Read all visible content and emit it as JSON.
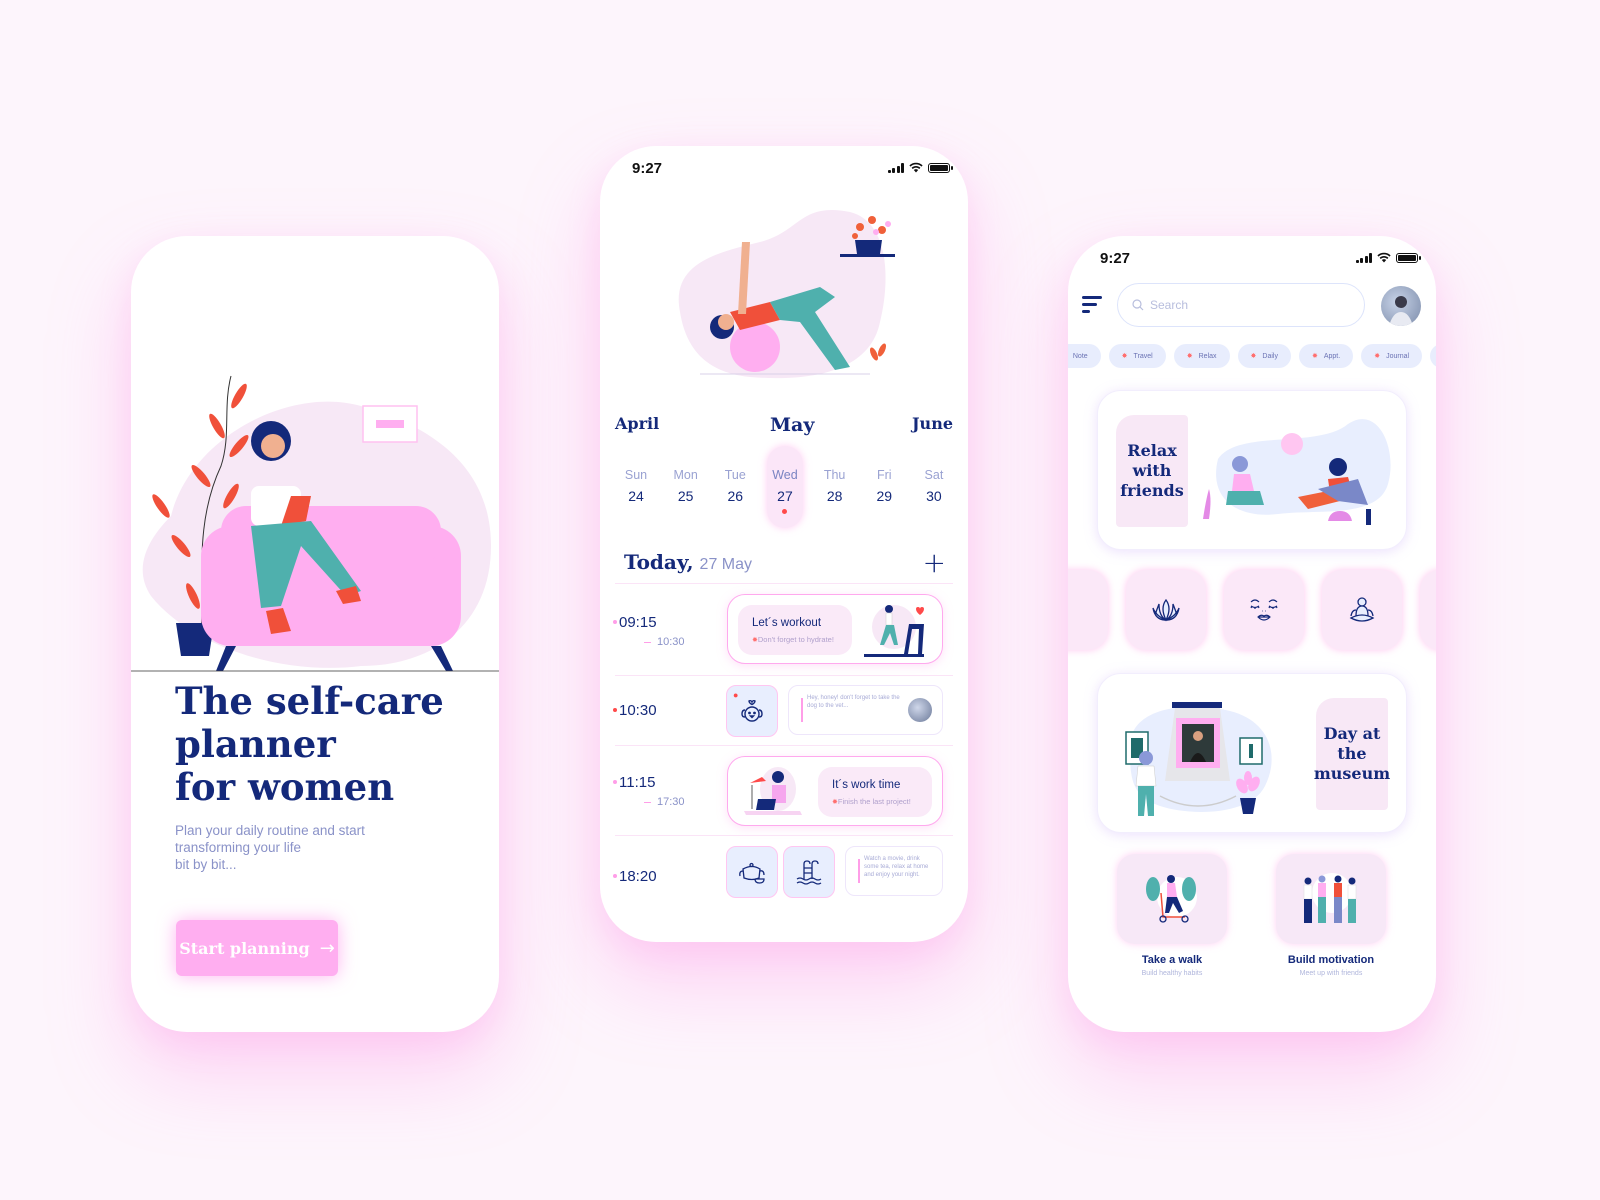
{
  "colors": {
    "navy": "#14297a",
    "pink": "#ffaef0",
    "soft_pink": "#faeaf8",
    "lavender": "#e8eefe",
    "red_dot": "#ff4a4a",
    "background": "#fdf5fc"
  },
  "onboarding": {
    "title_line1": "The self-care",
    "title_line2": "planner",
    "title_line3": "for women",
    "subtitle_line1": "Plan your daily routine and start",
    "subtitle_line2": "transforming your life",
    "subtitle_line3": "bit by bit...",
    "cta_label": "Start planning",
    "cta_icon": "arrow-right-icon"
  },
  "planner": {
    "status_time": "9:27",
    "months": {
      "prev": "April",
      "current": "May",
      "next": "June"
    },
    "days": [
      {
        "name": "Sun",
        "date": "24",
        "selected": false
      },
      {
        "name": "Mon",
        "date": "25",
        "selected": false
      },
      {
        "name": "Tue",
        "date": "26",
        "selected": false
      },
      {
        "name": "Wed",
        "date": "27",
        "selected": true
      },
      {
        "name": "Thu",
        "date": "28",
        "selected": false
      },
      {
        "name": "Fri",
        "date": "29",
        "selected": false
      },
      {
        "name": "Sat",
        "date": "30",
        "selected": false
      }
    ],
    "today_label": "Today,",
    "today_date": "27 May",
    "add_icon": "plus-icon",
    "schedule": [
      {
        "start": "09:15",
        "end": "10:30",
        "title": "Let´s workout",
        "note": "Don't forget to hydrate!"
      },
      {
        "start": "10:30",
        "icon": "dog-icon",
        "message": "Hey, honey! don't forget to take the dog to the vet..."
      },
      {
        "start": "11:15",
        "end": "17:30",
        "title": "It´s work time",
        "note": "Finish the last project!"
      },
      {
        "start": "18:20",
        "icons": [
          "teapot-icon",
          "pool-icon"
        ],
        "message": "Watch a movie, drink some tea, relax at home and enjoy your night."
      }
    ]
  },
  "discover": {
    "status_time": "9:27",
    "search_placeholder": "Search",
    "chips": [
      "Note",
      "Travel",
      "Relax",
      "Daily",
      "Appt.",
      "Journal",
      ""
    ],
    "features": [
      {
        "title": "Relax with friends",
        "lines": [
          "Relax",
          "with",
          "friends"
        ]
      },
      {
        "title": "Day at the museum",
        "lines": [
          "Day at",
          "the",
          "museum"
        ]
      }
    ],
    "categories": [
      "",
      "lotus-icon",
      "calm-face-icon",
      "meditation-icon",
      ""
    ],
    "activities": [
      {
        "title": "Take a walk",
        "subtitle": "Build healthy habits"
      },
      {
        "title": "Build motivation",
        "subtitle": "Meet up with friends"
      }
    ]
  }
}
